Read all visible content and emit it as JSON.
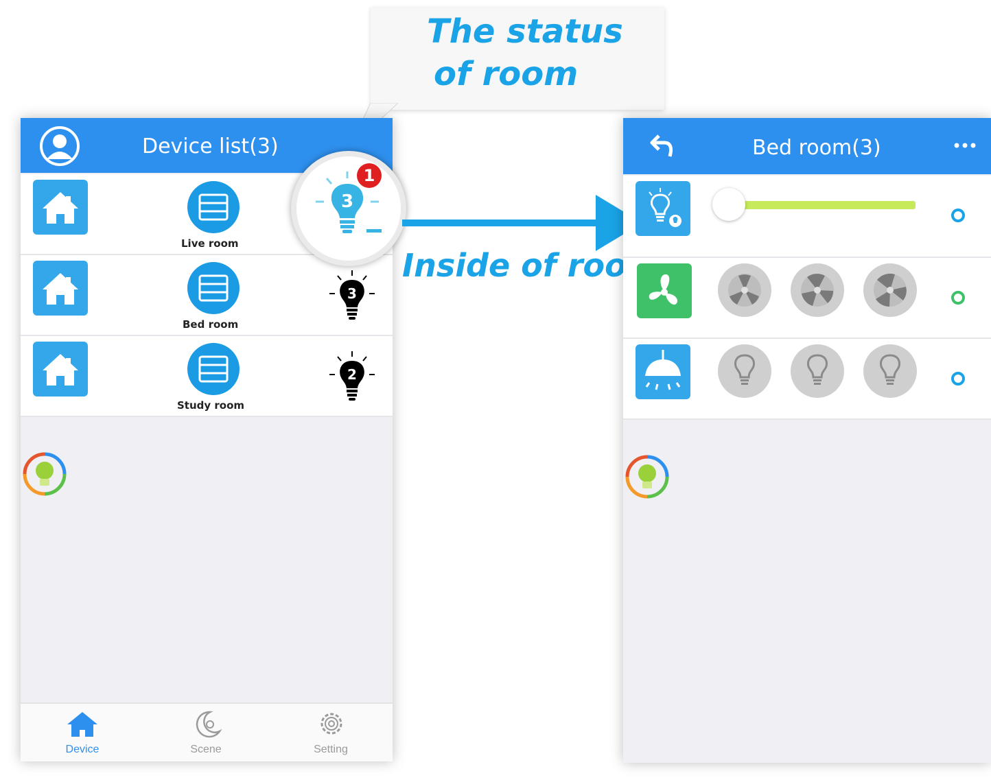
{
  "callout": {
    "line1": "The status",
    "line2": "of room"
  },
  "arrow_label": "Inside of room",
  "device_list": {
    "title": "Device list(3)",
    "rooms": [
      {
        "name": "Live room",
        "bulb_count": "3",
        "badge": "1",
        "bulb_state": "on"
      },
      {
        "name": "Bed room",
        "bulb_count": "3",
        "bulb_state": "off"
      },
      {
        "name": "Study room",
        "bulb_count": "2",
        "bulb_state": "off"
      }
    ],
    "tabs": [
      {
        "label": "Device",
        "icon": "home-icon",
        "active": true
      },
      {
        "label": "Scene",
        "icon": "moon-icon",
        "active": false
      },
      {
        "label": "Setting",
        "icon": "gear-icon",
        "active": false
      }
    ]
  },
  "room_detail": {
    "title": "Bed room(3)",
    "back_icon": "back-arrow-icon",
    "more_icon": "more-icon",
    "devices": [
      {
        "type": "dimmer-light",
        "icon": "dimmer-bulb-icon",
        "slider_level": 0.0,
        "status_color": "#1aa3e6"
      },
      {
        "type": "fan",
        "icon": "fan-icon",
        "options": [
          "fan-speed-1-icon",
          "fan-speed-2-icon",
          "fan-speed-3-icon"
        ],
        "status_color": "#3fc16a"
      },
      {
        "type": "ceiling-light",
        "icon": "ceiling-lamp-icon",
        "options": [
          "bulb-icon",
          "bulb-icon",
          "bulb-icon"
        ],
        "status_color": "#1aa3e6"
      }
    ]
  },
  "colors": {
    "accent": "#2e90ee",
    "callout_text": "#1aa3e6",
    "slider_track": "#c6ea5a"
  }
}
